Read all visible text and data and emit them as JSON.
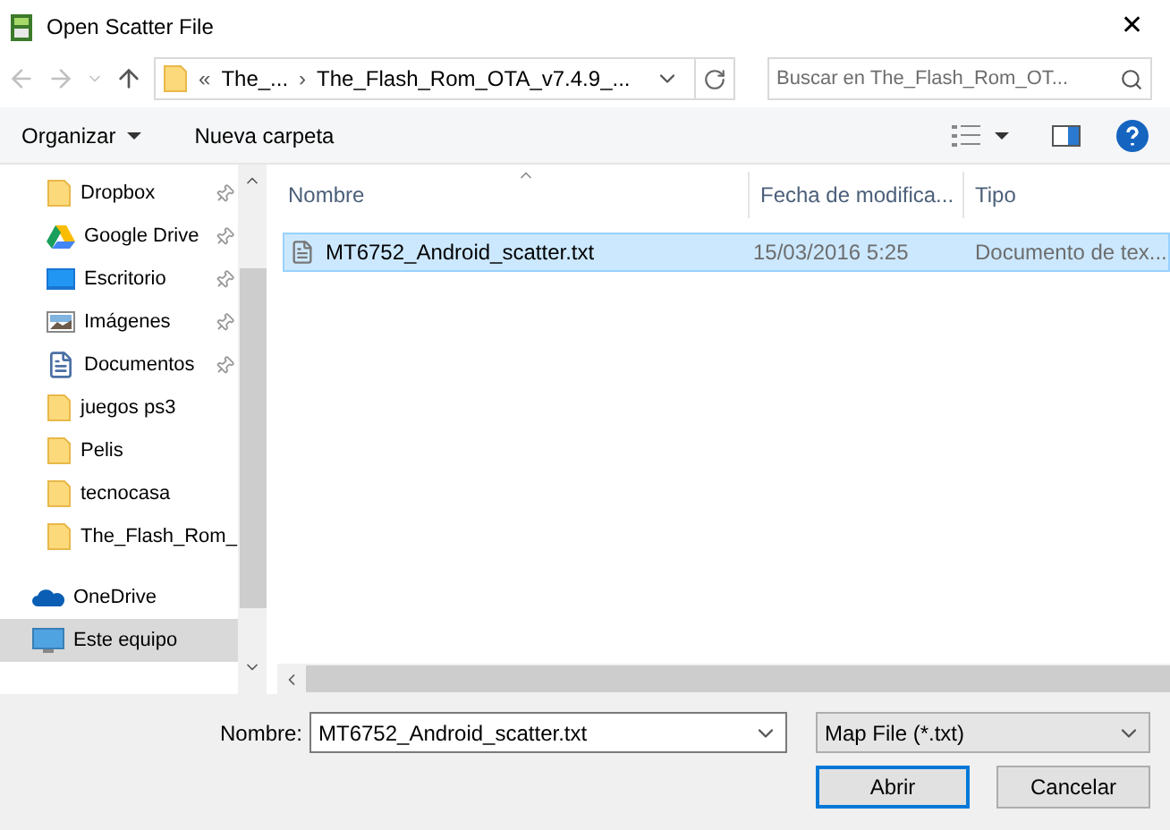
{
  "window": {
    "title": "Open Scatter File",
    "close": "✕"
  },
  "address": {
    "overflow": "«",
    "crumbs": [
      "The_...",
      "The_Flash_Rom_OTA_v7.4.9_..."
    ],
    "separator": "›"
  },
  "search": {
    "placeholder": "Buscar en The_Flash_Rom_OT..."
  },
  "toolbar": {
    "organize": "Organizar",
    "new_folder": "Nueva carpeta"
  },
  "sidebar": {
    "items": [
      {
        "label": "Dropbox",
        "kind": "folder",
        "pinned": true,
        "selected": false
      },
      {
        "label": "Google Drive",
        "kind": "drive",
        "pinned": true,
        "selected": false
      },
      {
        "label": "Escritorio",
        "kind": "desktop",
        "pinned": true,
        "selected": false
      },
      {
        "label": "Imágenes",
        "kind": "images",
        "pinned": true,
        "selected": false
      },
      {
        "label": "Documentos",
        "kind": "document",
        "pinned": true,
        "selected": false
      },
      {
        "label": "juegos ps3",
        "kind": "folder",
        "pinned": false,
        "selected": false
      },
      {
        "label": "Pelis",
        "kind": "folder",
        "pinned": false,
        "selected": false
      },
      {
        "label": "tecnocasa",
        "kind": "folder",
        "pinned": false,
        "selected": false
      },
      {
        "label": "The_Flash_Rom_",
        "kind": "folder",
        "pinned": false,
        "selected": false
      },
      {
        "label": "OneDrive",
        "kind": "cloud",
        "selected": false
      },
      {
        "label": "Este equipo",
        "kind": "computer",
        "selected": true
      }
    ]
  },
  "table": {
    "columns": [
      "Nombre",
      "Fecha de modifica...",
      "Tipo"
    ],
    "rows": [
      {
        "cells": [
          "MT6752_Android_scatter.txt",
          "15/03/2016 5:25",
          "Documento de tex..."
        ],
        "selected": true
      }
    ]
  },
  "footer": {
    "name_label": "Nombre:",
    "name_value": "MT6752_Android_scatter.txt",
    "filter": "Map File (*.txt)",
    "buttons": [
      {
        "label": "Abrir",
        "default": true
      },
      {
        "label": "Cancelar",
        "default": false
      }
    ]
  }
}
